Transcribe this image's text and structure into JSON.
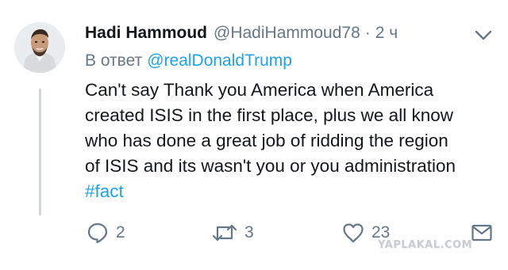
{
  "tweet": {
    "display_name": "Hadi Hammoud",
    "handle": "@HadiHammoud78",
    "separator": "·",
    "time": "2 ч",
    "reply_prefix": "В ответ",
    "reply_to": "@realDonaldTrump",
    "text_lines": [
      "Can't say Thank you America when America",
      "created ISIS in the first place, plus we all know",
      "who has done a great job of ridding the region",
      "of ISIS and its wasn't you or you administration"
    ],
    "hashtag": "#fact"
  },
  "actions": {
    "reply_count": "2",
    "retweet_count": "3",
    "like_count": "23"
  },
  "watermark": "YAPLAKAL.COM",
  "colors": {
    "link": "#1da1f2",
    "secondary_text": "#657786",
    "primary_text": "#14171a",
    "thread_line": "#ccd6dd"
  },
  "icons": [
    "avatar",
    "chevron-down-icon",
    "reply-icon",
    "retweet-icon",
    "heart-icon",
    "envelope-icon"
  ]
}
